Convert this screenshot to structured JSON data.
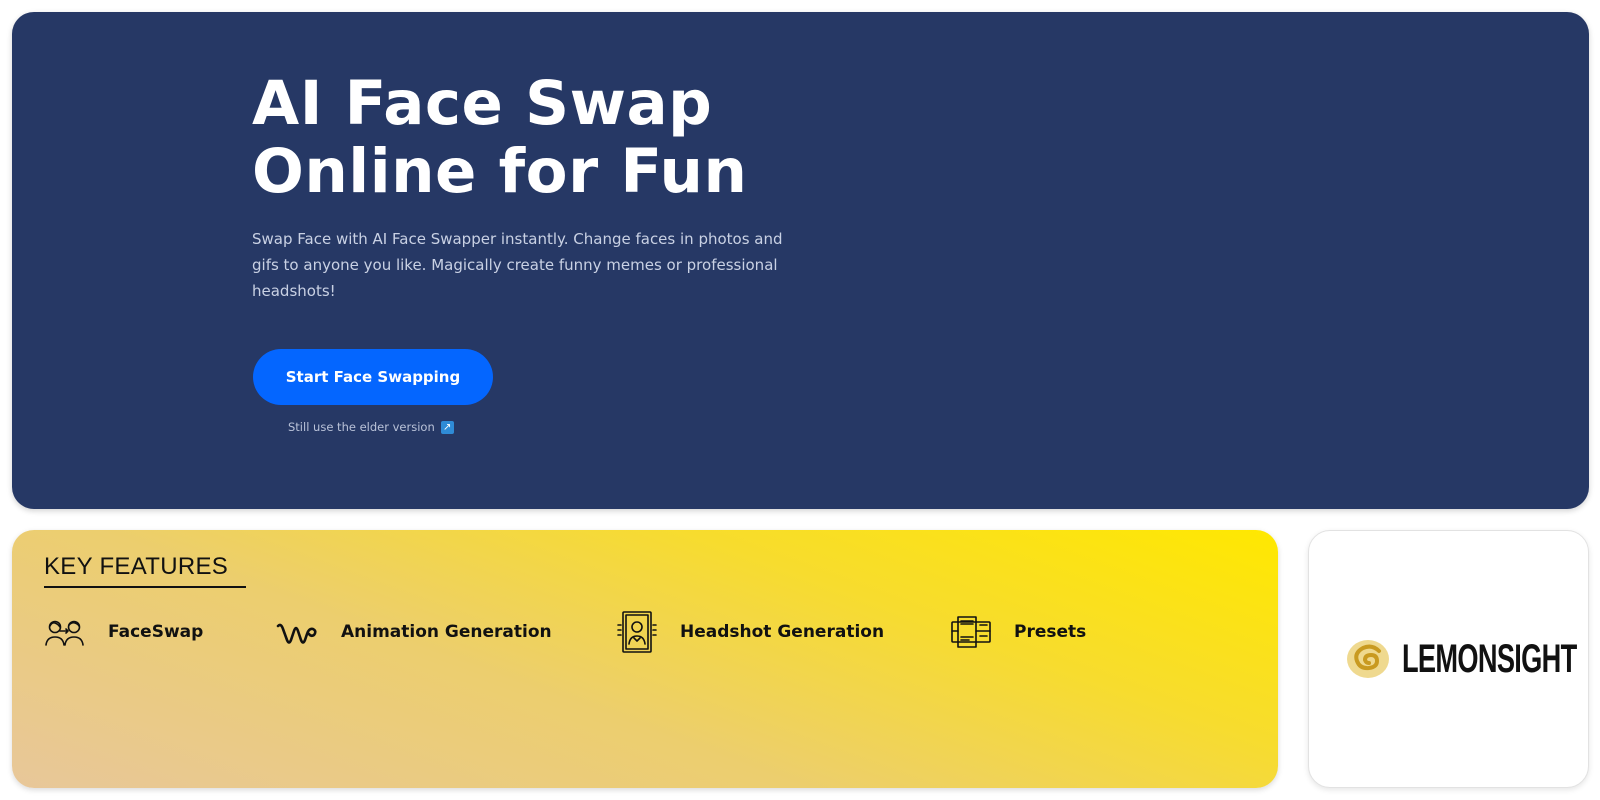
{
  "hero": {
    "title_line1": "AI Face Swap",
    "title_line2": "Online for Fun",
    "subtitle": "Swap Face with AI Face Swapper instantly. Change faces in photos and gifs to anyone you like. Magically create funny memes or professional headshots!",
    "cta_label": "Start Face Swapping",
    "elder_link": "Still use the elder version",
    "elder_icon": "external-link-icon"
  },
  "features": {
    "heading": "KEY FEATURES",
    "items": [
      {
        "label": "FaceSwap",
        "icon": "face-swap-icon"
      },
      {
        "label": "Animation Generation",
        "icon": "animation-icon"
      },
      {
        "label": "Headshot Generation",
        "icon": "headshot-icon"
      },
      {
        "label": "Presets",
        "icon": "presets-icon"
      }
    ]
  },
  "partner": {
    "name": "LEMONSIGHT",
    "icon": "lemonsight-logo-icon"
  },
  "colors": {
    "hero_bg": "#263865",
    "cta": "#0466ff",
    "features_gradient": [
      "#e8c79a",
      "#ffe800"
    ],
    "logo_accent": "#e7c466"
  }
}
